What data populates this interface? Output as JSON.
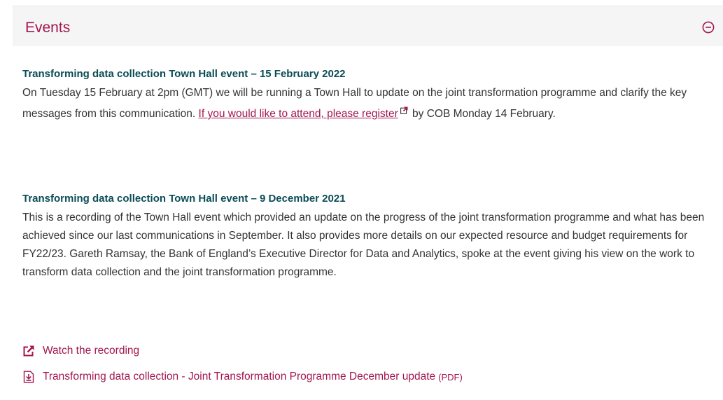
{
  "panel": {
    "title": "Events",
    "collapse_icon": "minus-circle-icon",
    "accent_color": "#a3174e",
    "heading_color": "#0b4d57"
  },
  "events": [
    {
      "heading": "Transforming data collection Town Hall event – 15 February 2022",
      "text_before": "On Tuesday 15 February at 2pm (GMT) we will be running a Town Hall to update on the joint transformation programme and clarify the key messages from this communication. ",
      "link_text": "If you would like to attend, please register",
      "text_after": " by COB Monday 14 February."
    },
    {
      "heading": "Transforming data collection Town Hall event – 9 December 2021",
      "text": "This is a recording of the Town Hall event which provided an update on the progress of the joint transformation programme and what has been achieved since our last communications in September. It also provides more details on our expected resource and budget requirements for FY22/23. Gareth Ramsay, the Bank of England’s Executive Director for Data and Analytics, spoke at the event giving his view on the work to transform data collection and the joint transformation programme."
    }
  ],
  "resources": [
    {
      "icon": "external-link-icon",
      "label": "Watch the recording"
    },
    {
      "icon": "pdf-download-icon",
      "label": "Transforming data collection - Joint Transformation Programme December update",
      "tag": "(PDF)"
    }
  ]
}
